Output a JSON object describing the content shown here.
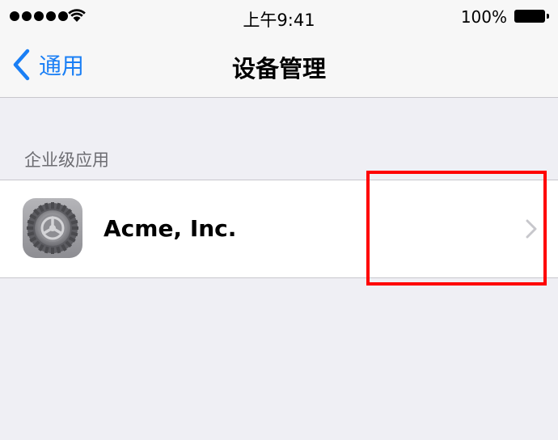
{
  "status_bar": {
    "time": "上午9:41",
    "battery_percent": "100%",
    "signal_bars": 5,
    "wifi_icon": "wifi-icon",
    "battery_icon": "battery-icon"
  },
  "nav": {
    "back_label": "通用",
    "title": "设备管理",
    "accent_color": "#1a7ff5"
  },
  "section": {
    "header": "企业级应用",
    "items": [
      {
        "label": "Acme, Inc.",
        "icon": "settings-gear-icon",
        "accessory": "chevron-right-icon"
      }
    ]
  },
  "annotation": {
    "highlight_color": "#ff0000"
  }
}
